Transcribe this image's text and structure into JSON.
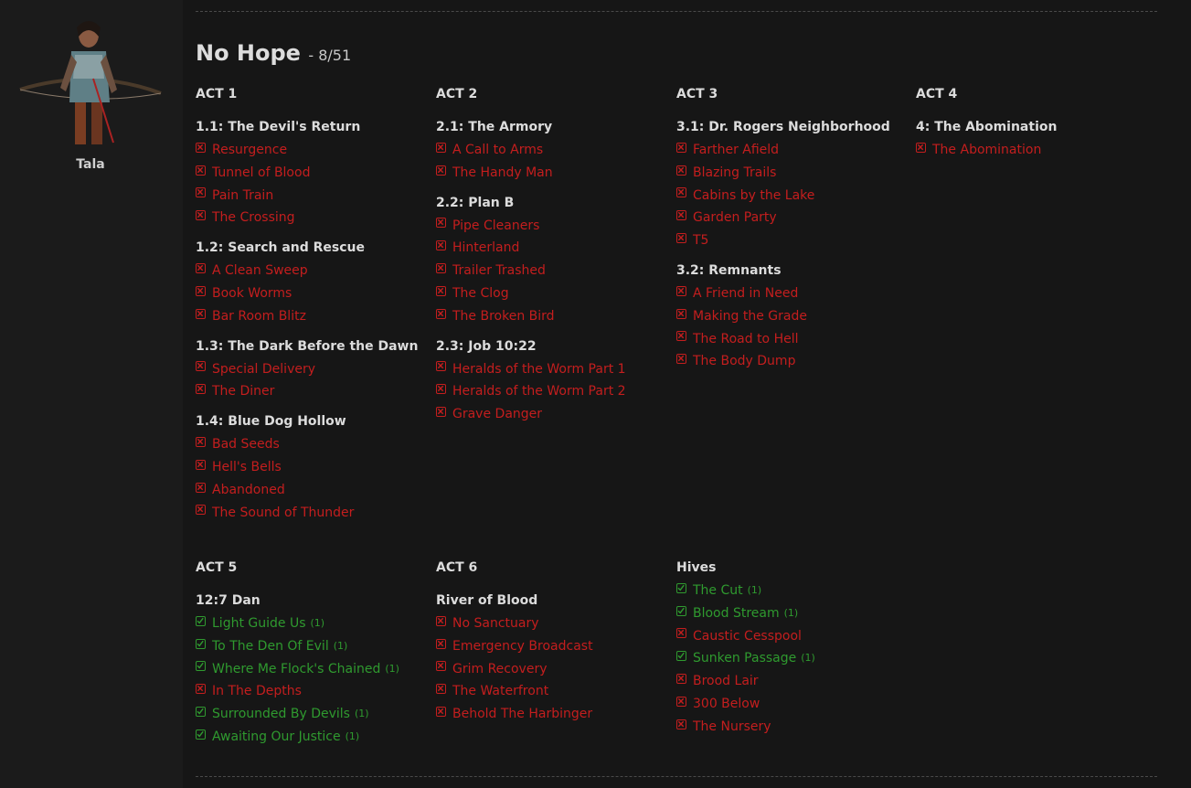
{
  "character": {
    "name": "Tala",
    "portrait_icon": "archer-portrait"
  },
  "difficulty": {
    "title": "No Hope",
    "progress": "- 8/51"
  },
  "colors": {
    "incomplete": "#c41e1e",
    "complete": "#2f9a2f",
    "background": "#161616"
  },
  "acts": [
    {
      "title": "ACT 1",
      "chapters": [
        {
          "title": "1.1: The Devil's Return",
          "missions": [
            {
              "name": "Resurgence",
              "done": false,
              "count": ""
            },
            {
              "name": "Tunnel of Blood",
              "done": false,
              "count": ""
            },
            {
              "name": "Pain Train",
              "done": false,
              "count": ""
            },
            {
              "name": "The Crossing",
              "done": false,
              "count": ""
            }
          ]
        },
        {
          "title": "1.2: Search and Rescue",
          "missions": [
            {
              "name": "A Clean Sweep",
              "done": false,
              "count": ""
            },
            {
              "name": "Book Worms",
              "done": false,
              "count": ""
            },
            {
              "name": "Bar Room Blitz",
              "done": false,
              "count": ""
            }
          ]
        },
        {
          "title": "1.3: The Dark Before the Dawn",
          "missions": [
            {
              "name": "Special Delivery",
              "done": false,
              "count": ""
            },
            {
              "name": "The Diner",
              "done": false,
              "count": ""
            }
          ]
        },
        {
          "title": "1.4: Blue Dog Hollow",
          "missions": [
            {
              "name": "Bad Seeds",
              "done": false,
              "count": ""
            },
            {
              "name": "Hell's Bells",
              "done": false,
              "count": ""
            },
            {
              "name": "Abandoned",
              "done": false,
              "count": ""
            },
            {
              "name": "The Sound of Thunder",
              "done": false,
              "count": ""
            }
          ]
        }
      ]
    },
    {
      "title": "ACT 2",
      "chapters": [
        {
          "title": "2.1: The Armory",
          "missions": [
            {
              "name": "A Call to Arms",
              "done": false,
              "count": ""
            },
            {
              "name": "The Handy Man",
              "done": false,
              "count": ""
            }
          ]
        },
        {
          "title": "2.2: Plan B",
          "missions": [
            {
              "name": "Pipe Cleaners",
              "done": false,
              "count": ""
            },
            {
              "name": "Hinterland",
              "done": false,
              "count": ""
            },
            {
              "name": "Trailer Trashed",
              "done": false,
              "count": ""
            },
            {
              "name": "The Clog",
              "done": false,
              "count": ""
            },
            {
              "name": "The Broken Bird",
              "done": false,
              "count": ""
            }
          ]
        },
        {
          "title": "2.3: Job 10:22",
          "missions": [
            {
              "name": "Heralds of the Worm Part 1",
              "done": false,
              "count": ""
            },
            {
              "name": "Heralds of the Worm Part 2",
              "done": false,
              "count": ""
            },
            {
              "name": "Grave Danger",
              "done": false,
              "count": ""
            }
          ]
        }
      ]
    },
    {
      "title": "ACT 3",
      "chapters": [
        {
          "title": "3.1: Dr. Rogers Neighborhood",
          "missions": [
            {
              "name": "Farther Afield",
              "done": false,
              "count": ""
            },
            {
              "name": "Blazing Trails",
              "done": false,
              "count": ""
            },
            {
              "name": "Cabins by the Lake",
              "done": false,
              "count": ""
            },
            {
              "name": "Garden Party",
              "done": false,
              "count": ""
            },
            {
              "name": "T5",
              "done": false,
              "count": ""
            }
          ]
        },
        {
          "title": "3.2: Remnants",
          "missions": [
            {
              "name": "A Friend in Need",
              "done": false,
              "count": ""
            },
            {
              "name": "Making the Grade",
              "done": false,
              "count": ""
            },
            {
              "name": "The Road to Hell",
              "done": false,
              "count": ""
            },
            {
              "name": "The Body Dump",
              "done": false,
              "count": ""
            }
          ]
        }
      ]
    },
    {
      "title": "ACT 4",
      "chapters": [
        {
          "title": "4: The Abomination",
          "missions": [
            {
              "name": "The Abomination",
              "done": false,
              "count": ""
            }
          ]
        }
      ]
    },
    {
      "title": "ACT 5",
      "chapters": [
        {
          "title": "12:7 Dan",
          "missions": [
            {
              "name": "Light Guide Us",
              "done": true,
              "count": "(1)"
            },
            {
              "name": "To The Den Of Evil",
              "done": true,
              "count": "(1)"
            },
            {
              "name": "Where Me Flock's Chained",
              "done": true,
              "count": "(1)"
            },
            {
              "name": "In The Depths",
              "done": false,
              "count": ""
            },
            {
              "name": "Surrounded By Devils",
              "done": true,
              "count": "(1)"
            },
            {
              "name": "Awaiting Our Justice",
              "done": true,
              "count": "(1)"
            }
          ]
        }
      ]
    },
    {
      "title": "ACT 6",
      "chapters": [
        {
          "title": "River of Blood",
          "missions": [
            {
              "name": "No Sanctuary",
              "done": false,
              "count": ""
            },
            {
              "name": "Emergency Broadcast",
              "done": false,
              "count": ""
            },
            {
              "name": "Grim Recovery",
              "done": false,
              "count": ""
            },
            {
              "name": "The Waterfront",
              "done": false,
              "count": ""
            },
            {
              "name": "Behold The Harbinger",
              "done": false,
              "count": ""
            }
          ]
        }
      ]
    },
    {
      "title": "Hives",
      "chapters": [
        {
          "title": "",
          "missions": [
            {
              "name": "The Cut",
              "done": true,
              "count": "(1)"
            },
            {
              "name": "Blood Stream",
              "done": true,
              "count": "(1)"
            },
            {
              "name": "Caustic Cesspool",
              "done": false,
              "count": ""
            },
            {
              "name": "Sunken Passage",
              "done": true,
              "count": "(1)"
            },
            {
              "name": "Brood Lair",
              "done": false,
              "count": ""
            },
            {
              "name": "300 Below",
              "done": false,
              "count": ""
            },
            {
              "name": "The Nursery",
              "done": false,
              "count": ""
            }
          ]
        }
      ]
    }
  ]
}
